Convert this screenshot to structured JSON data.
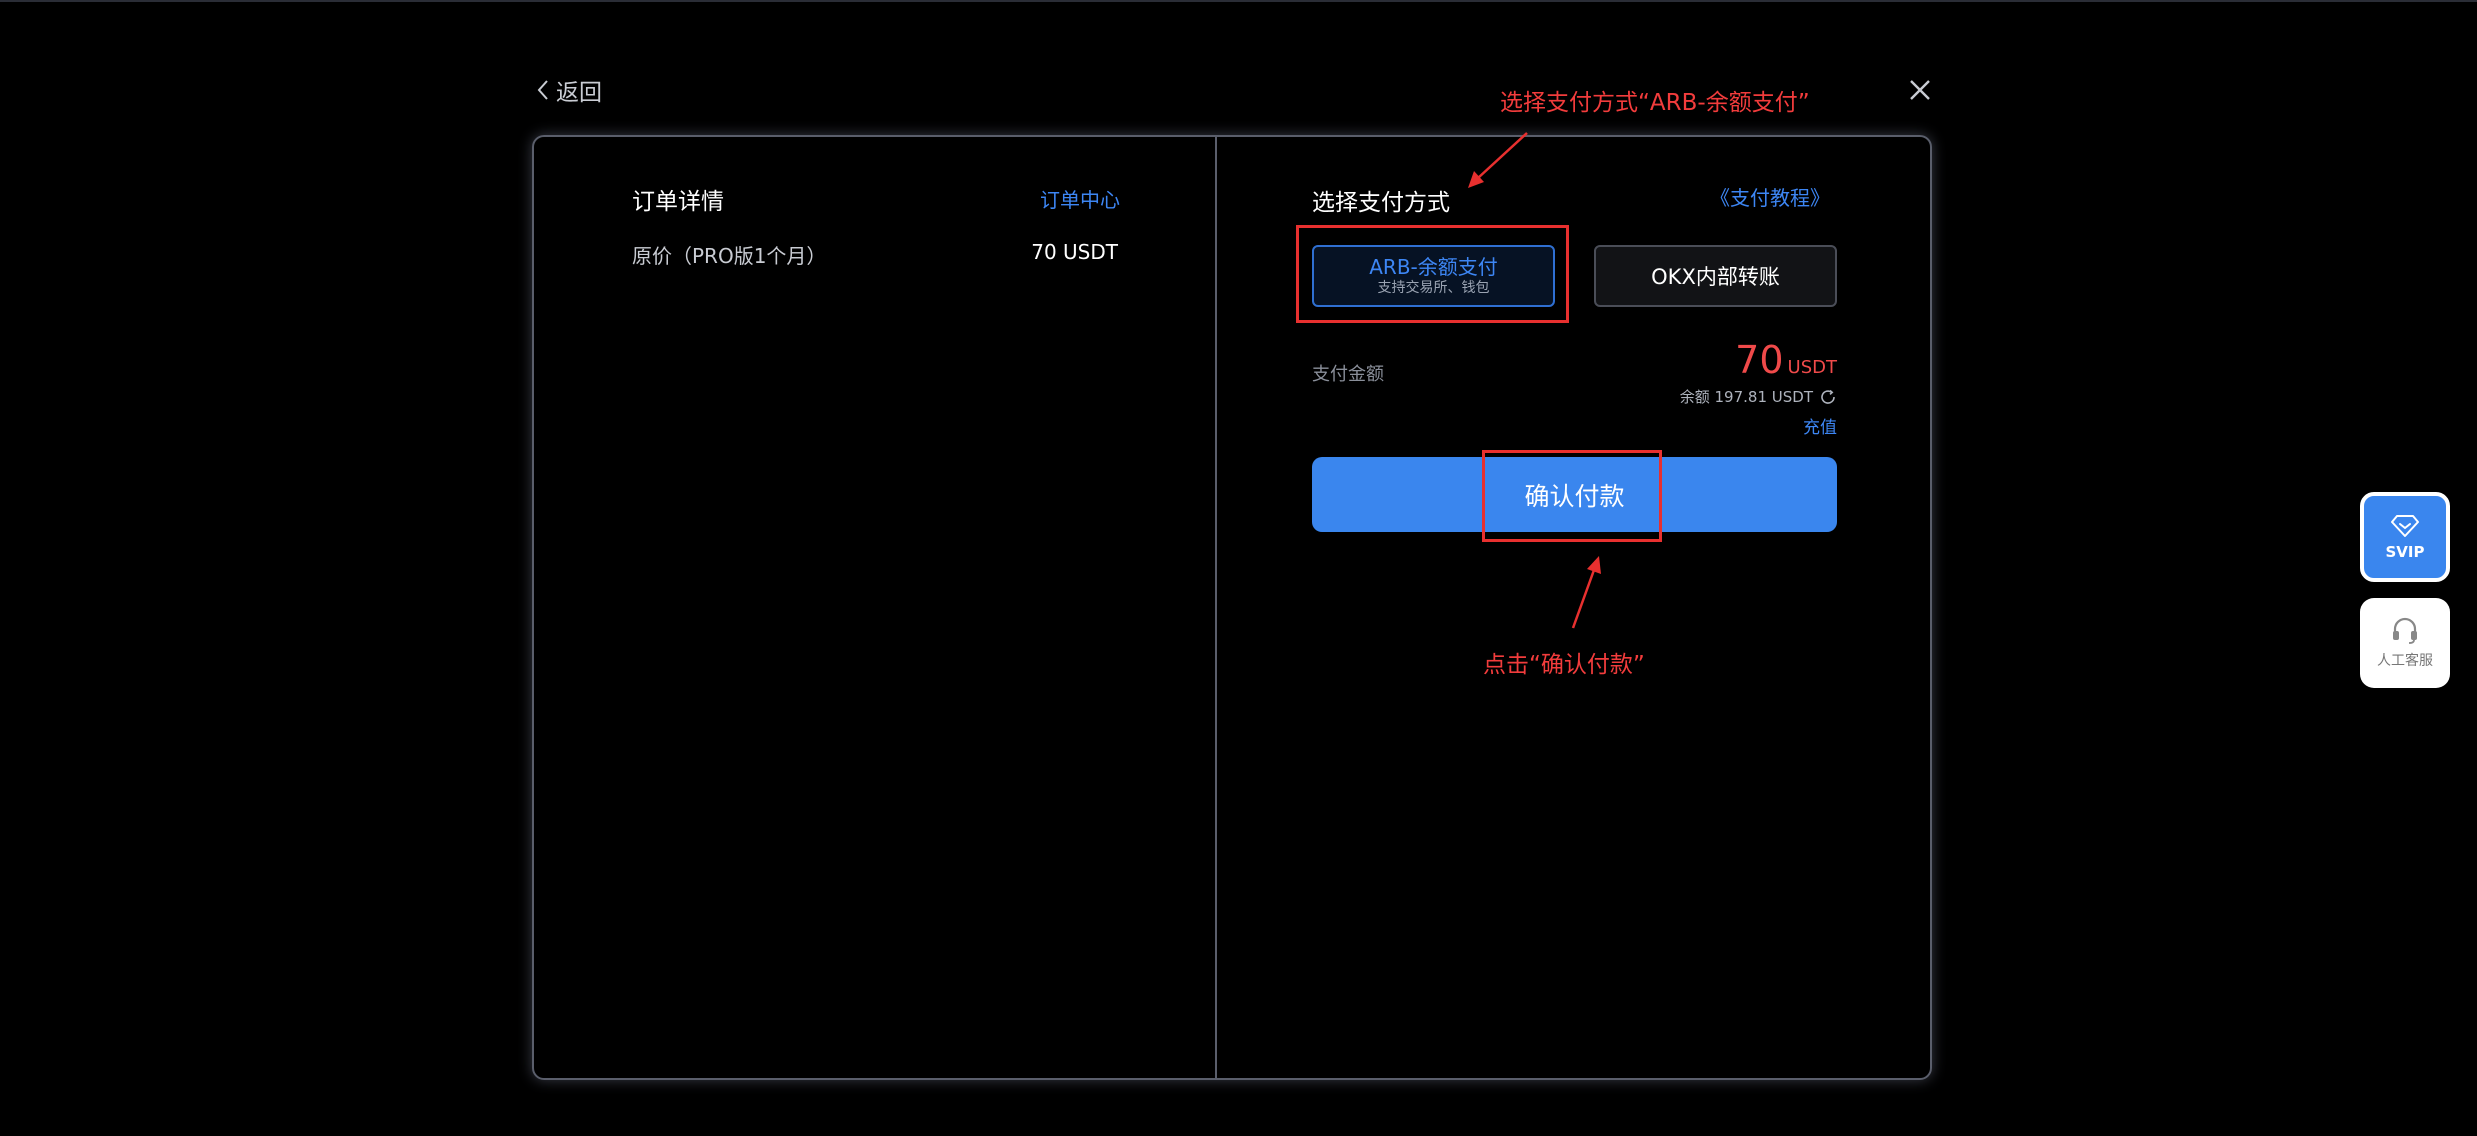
{
  "header": {
    "back_label": "返回",
    "close_icon": "close-icon"
  },
  "order": {
    "title": "订单详情",
    "order_center_link": "订单中心",
    "price_label": "原价（PRO版1个月）",
    "price_value": "70 USDT"
  },
  "payment": {
    "title": "选择支付方式",
    "tutorial_link": "《支付教程》",
    "options": [
      {
        "label": "ARB-余额支付",
        "sublabel": "支持交易所、钱包",
        "selected": true
      },
      {
        "label": "OKX内部转账",
        "selected": false
      }
    ],
    "amount_label": "支付金额",
    "amount_value": "70",
    "amount_unit": "USDT",
    "balance_text": "余额 197.81 USDT",
    "refresh_icon": "refresh-icon",
    "recharge_link": "充值",
    "confirm_button": "确认付款"
  },
  "annotations": {
    "select_hint": "选择支付方式“ARB-余额支付”",
    "click_hint": "点击“确认付款”",
    "color": "#e8302f"
  },
  "floating": {
    "svip_label": "SVIP",
    "svip_icon": "diamond-icon",
    "support_label": "人工客服",
    "support_icon": "headset-icon"
  },
  "colors": {
    "accent": "#3a86ee",
    "link": "#3d86f4",
    "amount": "#f04a4a",
    "background": "#000000"
  }
}
